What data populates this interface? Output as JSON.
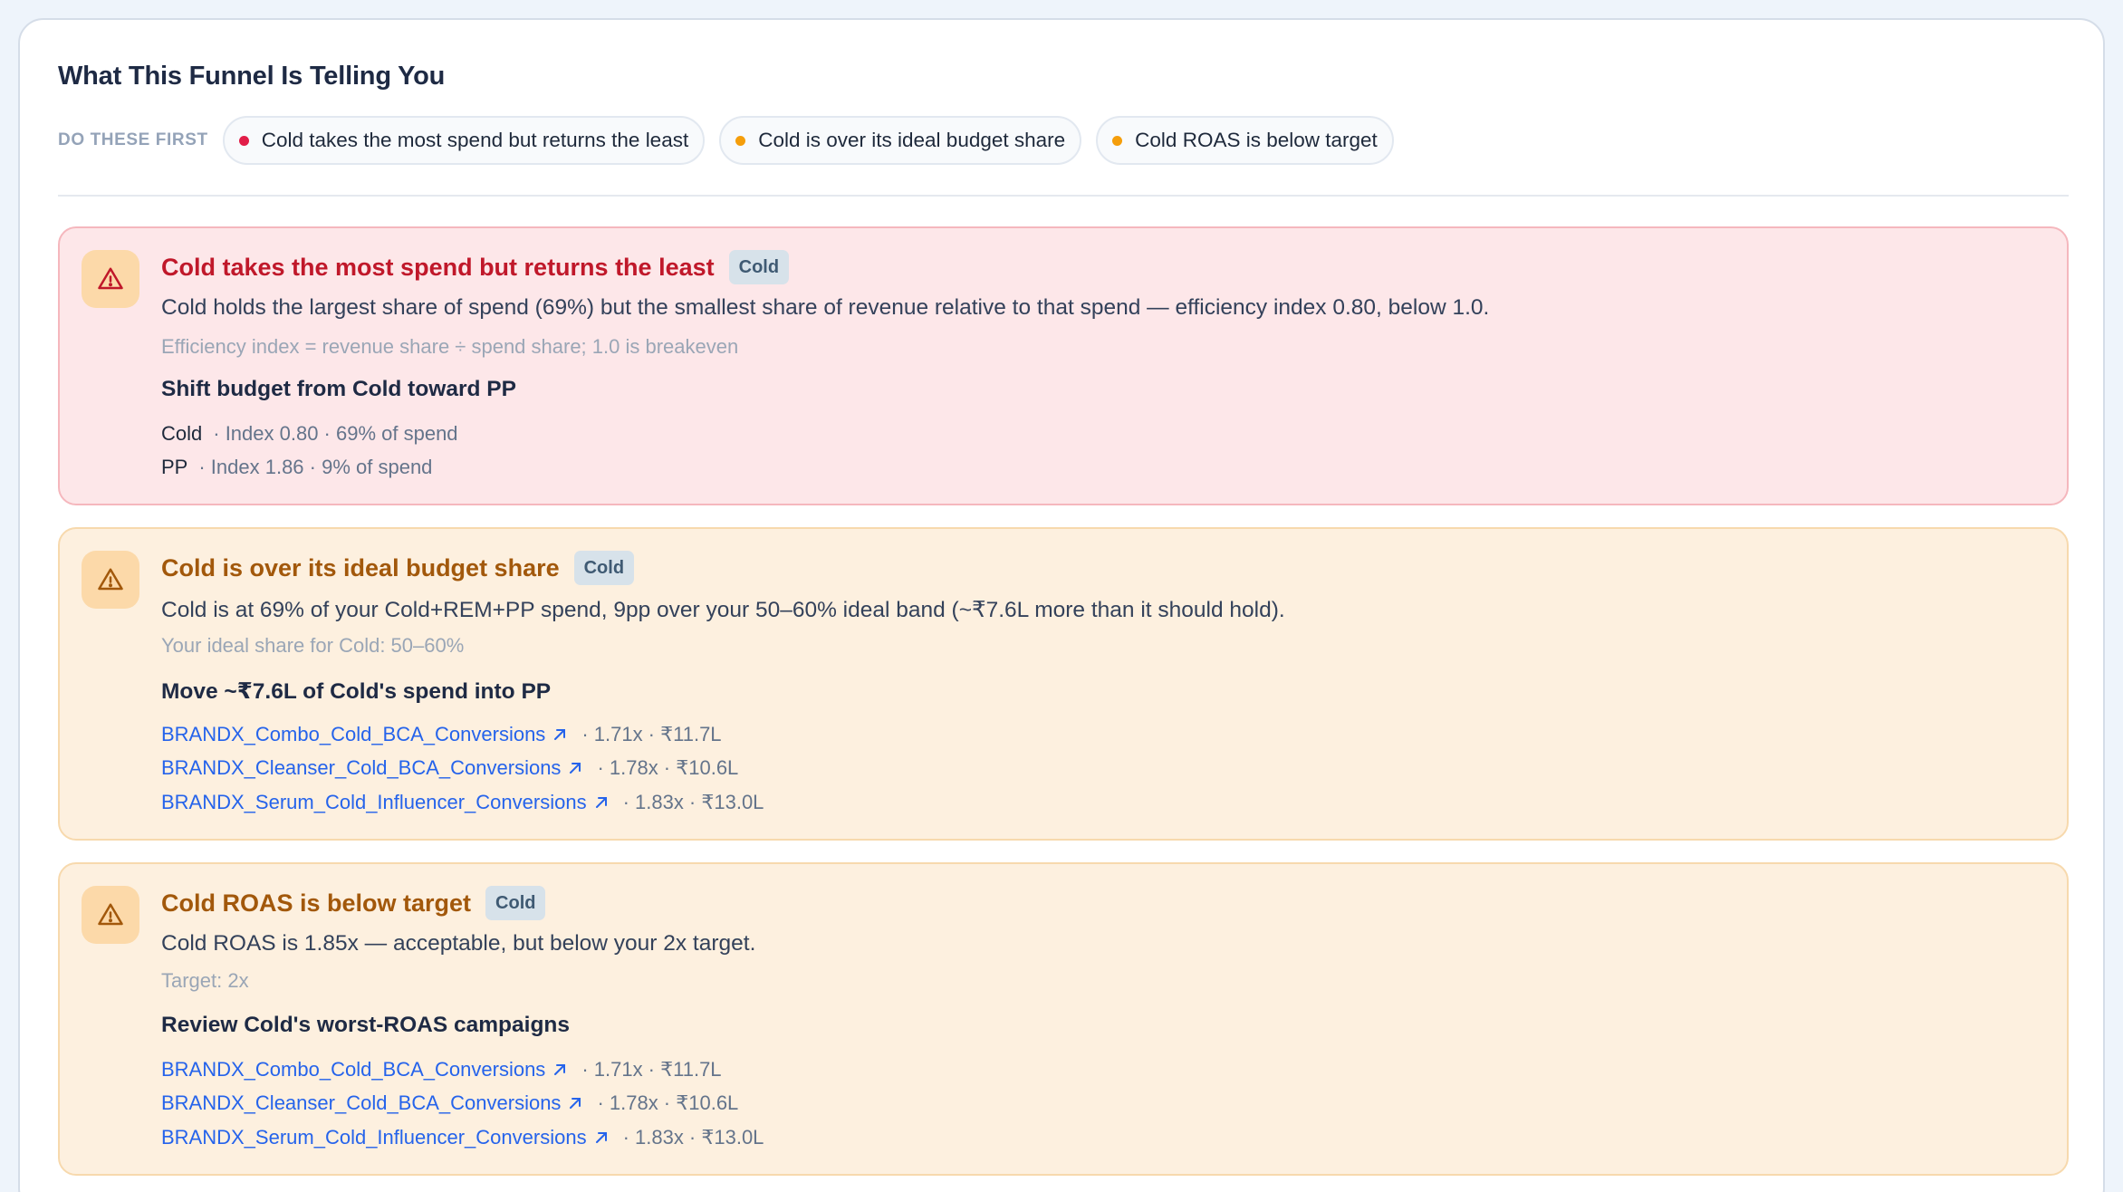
{
  "panel": {
    "title": "What This Funnel Is Telling You",
    "priority_label": "DO THESE FIRST",
    "chips": [
      {
        "label": "Cold takes the most spend but returns the least",
        "dot_color": "#e11d48"
      },
      {
        "label": "Cold is over its ideal budget share",
        "dot_color": "#f59e0b"
      },
      {
        "label": "Cold ROAS is below target",
        "dot_color": "#f59e0b"
      }
    ]
  },
  "cards": [
    {
      "severity": "high",
      "title": "Cold takes the most spend but returns the least",
      "tag": "Cold",
      "description": "Cold holds the largest share of spend (69%) but the smallest share of revenue relative to that spend — efficiency index 0.80, below 1.0.",
      "note": "Efficiency index = revenue share ÷ spend share; 1.0 is breakeven",
      "action": "Shift budget from Cold toward PP",
      "segments": [
        {
          "name": "Cold",
          "meta": "· Index 0.80 · 69% of spend"
        },
        {
          "name": "PP",
          "meta": "· Index 1.86 · 9% of spend"
        }
      ]
    },
    {
      "severity": "medium",
      "title": "Cold is over its ideal budget share",
      "tag": "Cold",
      "description": "Cold is at 69% of your Cold+REM+PP spend, 9pp over your 50–60% ideal band (~₹7.6L more than it should hold).",
      "note": "Your ideal share for Cold: 50–60%",
      "action": "Move ~₹7.6L of Cold's spend into PP",
      "campaigns": [
        {
          "name": "BRANDX_Combo_Cold_BCA_Conversions",
          "meta": "· 1.71x · ₹11.7L"
        },
        {
          "name": "BRANDX_Cleanser_Cold_BCA_Conversions",
          "meta": "· 1.78x · ₹10.6L"
        },
        {
          "name": "BRANDX_Serum_Cold_Influencer_Conversions",
          "meta": "· 1.83x · ₹13.0L"
        }
      ]
    },
    {
      "severity": "medium",
      "title": "Cold ROAS is below target",
      "tag": "Cold",
      "description": "Cold ROAS is 1.85x — acceptable, but below your 2x target.",
      "note": "Target: 2x",
      "action": "Review Cold's worst-ROAS campaigns",
      "campaigns": [
        {
          "name": "BRANDX_Combo_Cold_BCA_Conversions",
          "meta": "· 1.71x · ₹11.7L"
        },
        {
          "name": "BRANDX_Cleanser_Cold_BCA_Conversions",
          "meta": "· 1.78x · ₹10.6L"
        },
        {
          "name": "BRANDX_Serum_Cold_Influencer_Conversions",
          "meta": "· 1.83x · ₹13.0L"
        }
      ]
    }
  ],
  "colors": {
    "high_title": "#c0182a",
    "medium_title": "#a2580b",
    "link": "#2563eb"
  }
}
